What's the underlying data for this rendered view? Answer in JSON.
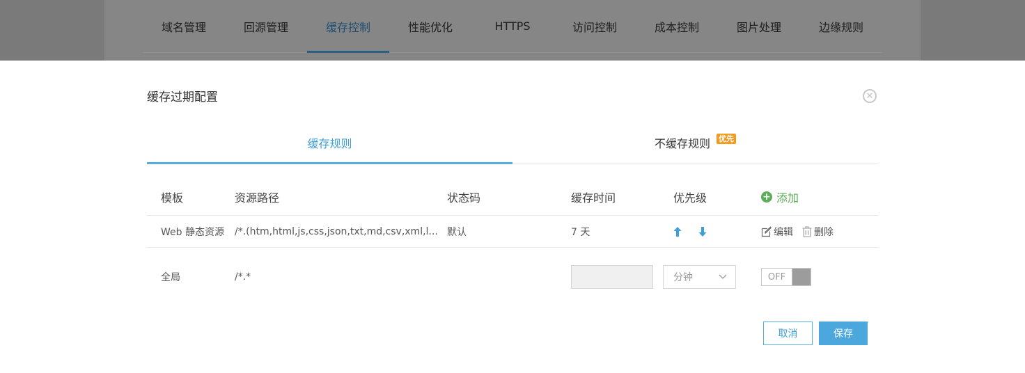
{
  "top_tabs": [
    "域名管理",
    "回源管理",
    "缓存控制",
    "性能优化",
    "HTTPS",
    "访问控制",
    "成本控制",
    "图片处理",
    "边缘规则"
  ],
  "modal": {
    "title": "缓存过期配置",
    "close_icon": "close-circle-icon",
    "tabs": [
      {
        "label": "缓存规则",
        "active": true
      },
      {
        "label": "不缓存规则",
        "badge": "优先"
      }
    ]
  },
  "table": {
    "headers": {
      "template": "模板",
      "path": "资源路径",
      "status": "状态码",
      "time": "缓存时间",
      "priority": "优先级",
      "add": "添加"
    },
    "rows": [
      {
        "template": "Web 静态资源",
        "path": "/*.(htm,html,js,css,json,txt,md,csv,xml,l...",
        "status": "默认",
        "time": "7 天",
        "edit": "编辑",
        "delete": "删除"
      },
      {
        "template": "全局",
        "path": "/*.*",
        "time_value": "",
        "unit": "分钟",
        "toggle": "OFF"
      }
    ]
  },
  "footer": {
    "cancel": "取消",
    "save": "保存"
  },
  "colors": {
    "accent": "#3d9fd7",
    "add_green": "#5aae58",
    "badge_orange": "#f39a1e",
    "save_button": "#4ba7dc"
  }
}
